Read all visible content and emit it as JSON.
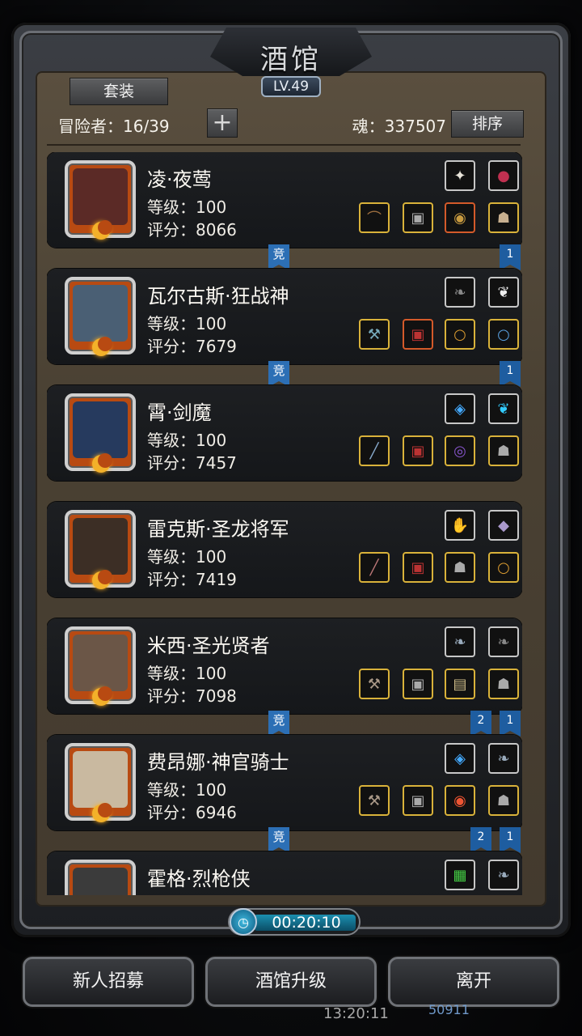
{
  "header": {
    "title": "酒馆",
    "level": "LV.49",
    "suit_button": "套装"
  },
  "stats": {
    "adventurers": "冒险者：16/39",
    "plus": "+",
    "soul": "魂：337507",
    "sort_button": "排序"
  },
  "cards": [
    {
      "name": "凌·夜莺",
      "level": "等级：100",
      "score": "评分：8066",
      "face": "#5b2a26"
    },
    {
      "name": "瓦尔古斯·狂战神",
      "level": "等级：100",
      "score": "评分：7679",
      "face": "#4a5f74"
    },
    {
      "name": "霄·剑魔",
      "level": "等级：100",
      "score": "评分：7457",
      "face": "#263a5e"
    },
    {
      "name": "雷克斯·圣龙将军",
      "level": "等级：100",
      "score": "评分：7419",
      "face": "#3c2e25"
    },
    {
      "name": "米西·圣光贤者",
      "level": "等级：100",
      "score": "评分：7098",
      "face": "#6b5647"
    },
    {
      "name": "费昂娜·神官骑士",
      "level": "等级：100",
      "score": "评分：6946",
      "face": "#c9b9a0"
    },
    {
      "name": "霍格·烈枪侠",
      "level": "",
      "score": "",
      "face": "#3b3b3b"
    }
  ],
  "ribbons": {
    "jing": "竞",
    "one": "1",
    "two": "2"
  },
  "timer": "00:20:10",
  "buttons": {
    "recruit": "新人招募",
    "upgrade": "酒馆升级",
    "leave": "离开"
  },
  "status": {
    "time": "13:20:11",
    "value": "50911"
  }
}
